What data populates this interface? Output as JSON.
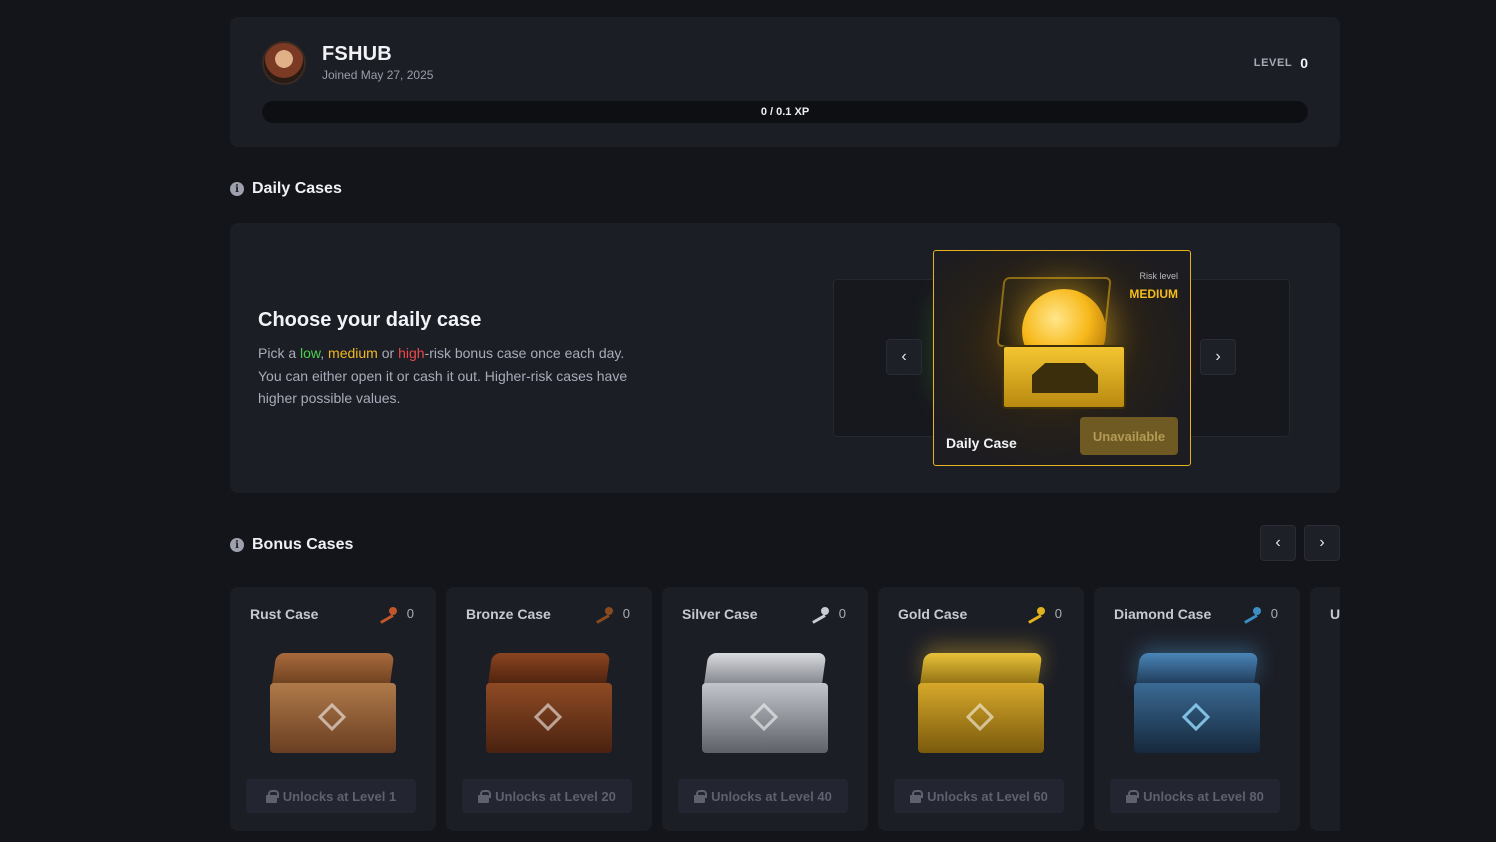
{
  "profile": {
    "username": "FSHUB",
    "joined": "Joined May 27, 2025",
    "level_label": "LEVEL",
    "level_value": "0",
    "xp_text": "0 / 0.1 XP",
    "xp_progress": 0
  },
  "daily": {
    "section_title": "Daily Cases",
    "heading": "Choose your daily case",
    "desc_pick": "Pick a ",
    "desc_low": "low",
    "desc_comma": ", ",
    "desc_medium": "medium",
    "desc_or": " or ",
    "desc_high": "high",
    "desc_rest": "-risk bonus case once each day. You can either open it or cash it out. Higher-risk cases have higher possible values.",
    "risk_label": "Risk level",
    "risk_value": "MEDIUM",
    "case_label": "Daily Case",
    "button_label": "Unavailable",
    "prev_icon": "‹",
    "next_icon": "›",
    "colors": {
      "low": "#4ad04a",
      "medium": "#f2b81f",
      "high": "#f04848"
    }
  },
  "bonus": {
    "section_title": "Bonus Cases",
    "prev_icon": "‹",
    "next_icon": "›",
    "cases": [
      {
        "name": "Rust Case",
        "keys": "0",
        "unlock": "Unlocks at Level 1",
        "key_color": "#c0562a"
      },
      {
        "name": "Bronze Case",
        "keys": "0",
        "unlock": "Unlocks at Level 20",
        "key_color": "#8a4a1e"
      },
      {
        "name": "Silver Case",
        "keys": "0",
        "unlock": "Unlocks at Level 40",
        "key_color": "#c9ccd3"
      },
      {
        "name": "Gold Case",
        "keys": "0",
        "unlock": "Unlocks at Level 60",
        "key_color": "#e2b21c"
      },
      {
        "name": "Diamond Case",
        "keys": "0",
        "unlock": "Unlocks at Level 80",
        "key_color": "#3c8ec4"
      },
      {
        "name": "U"
      }
    ]
  }
}
